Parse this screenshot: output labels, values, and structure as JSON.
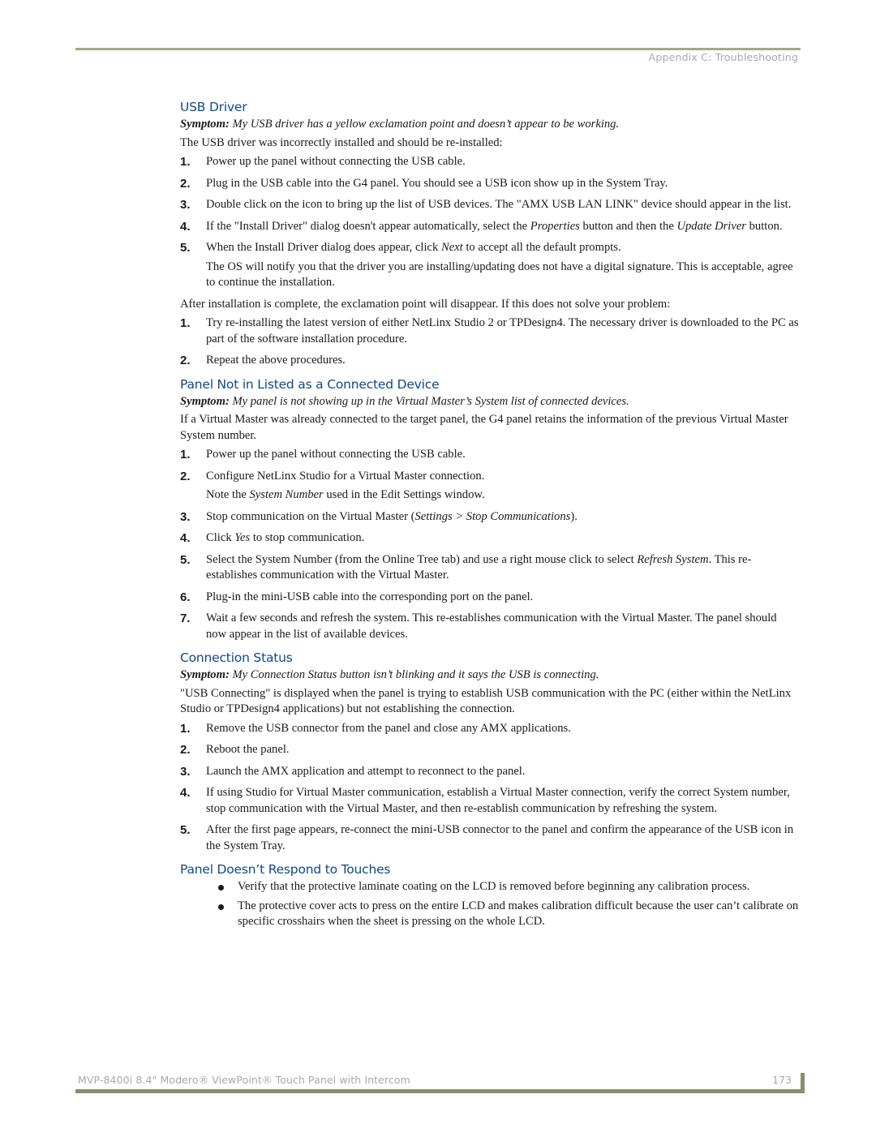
{
  "header": {
    "running_head": "Appendix C: Troubleshooting"
  },
  "footer": {
    "title": "MVP-8400i 8.4\" Modero® ViewPoint® Touch Panel with Intercom",
    "page_number": "173"
  },
  "colors": {
    "heading": "#0f4a86",
    "rule": "#a7a585",
    "footer_bar": "#8e8a6c",
    "muted_text": "#a8a8a8"
  },
  "sections": {
    "usb_driver": {
      "title": "USB Driver",
      "symptom_label": "Symptom:",
      "symptom_text": " My USB driver has a yellow exclamation point and doesn’t appear to be working.",
      "intro": "The USB driver was incorrectly installed and should be re-installed:",
      "steps": [
        {
          "num": "1.",
          "text": "Power up the panel without connecting the USB cable."
        },
        {
          "num": "2.",
          "text": "Plug in the USB cable into the G4 panel. You should see a USB icon show up in the System Tray."
        },
        {
          "num": "3.",
          "text": "Double click on the icon to bring up the list of USB devices. The \"AMX USB LAN LINK\" device should appear in the list."
        },
        {
          "num": "4.",
          "text_a": "If the \"Install Driver\" dialog doesn't appear automatically, select the ",
          "em_a": "Properties",
          "text_b": " button and then the ",
          "em_b": "Update Driver",
          "text_c": " button."
        },
        {
          "num": "5.",
          "text_a": "When the Install Driver dialog does appear, click ",
          "em_a": "Next",
          "text_b": " to accept all the default prompts.",
          "note": "The OS will notify you that the driver you are installing/updating does not have a digital signature. This is acceptable, agree to continue the installation."
        }
      ],
      "after": "After installation is complete, the exclamation point will disappear. If this does not solve your problem:",
      "steps2": [
        {
          "num": "1.",
          "text": "Try re-installing the latest version of either NetLinx Studio 2 or TPDesign4. The necessary driver is downloaded to the PC as part of the software installation procedure."
        },
        {
          "num": "2.",
          "text": "Repeat the above procedures."
        }
      ]
    },
    "panel_not_listed": {
      "title": "Panel Not in Listed as a Connected Device",
      "symptom_label": "Symptom:",
      "symptom_text": " My panel is not showing up in the Virtual Master’s System list of connected devices.",
      "intro": "If a Virtual Master was already connected to the target panel, the G4 panel retains the information of the previous Virtual Master System number.",
      "steps": [
        {
          "num": "1.",
          "text": "Power up the panel without connecting the USB cable."
        },
        {
          "num": "2.",
          "text": "Configure NetLinx Studio for a Virtual Master connection.",
          "note_a": "Note the ",
          "note_em": "System Number",
          "note_b": " used in the Edit Settings window."
        },
        {
          "num": "3.",
          "text_a": "Stop communication on the Virtual Master (",
          "em_a": "Settings > Stop Communications",
          "text_b": ")."
        },
        {
          "num": "4.",
          "text_a": "Click ",
          "em_a": "Yes",
          "text_b": " to stop communication."
        },
        {
          "num": "5.",
          "text_a": "Select the System Number (from the Online Tree tab) and use a right mouse click to select ",
          "em_a": "Refresh System",
          "text_b": ". This re-establishes communication with the Virtual Master."
        },
        {
          "num": "6.",
          "text": "Plug-in the mini-USB cable into the corresponding port on the panel."
        },
        {
          "num": "7.",
          "text": "Wait a few seconds and refresh the system. This re-establishes communication with the Virtual Master. The panel should now appear in the list of available devices."
        }
      ]
    },
    "connection_status": {
      "title": "Connection Status",
      "symptom_label": "Symptom:",
      "symptom_text": " My Connection Status button isn’t blinking and it says the USB is connecting.",
      "intro": "\"USB Connecting\" is displayed when the panel is trying to establish USB communication with the PC (either within the NetLinx Studio or TPDesign4 applications) but not establishing the connection.",
      "steps": [
        {
          "num": "1.",
          "text": "Remove the USB connector from the panel and close any AMX applications."
        },
        {
          "num": "2.",
          "text": "Reboot the panel."
        },
        {
          "num": "3.",
          "text": "Launch the AMX application and attempt to reconnect to the panel."
        },
        {
          "num": "4.",
          "text": "If using Studio for Virtual Master communication, establish a Virtual Master connection, verify the correct System number, stop communication with the Virtual Master, and then re-establish communication by refreshing the system."
        },
        {
          "num": "5.",
          "text": "After the first page appears, re-connect the mini-USB connector to the panel and confirm the appearance of the USB icon in the System Tray."
        }
      ]
    },
    "touches": {
      "title": "Panel Doesn’t Respond to Touches",
      "bullets": [
        "Verify that the protective laminate coating on the LCD is removed before beginning any calibration process.",
        "The protective cover acts to press on the entire LCD and makes calibration difficult because the user can’t calibrate on specific crosshairs when the sheet is pressing on the whole LCD."
      ]
    }
  }
}
